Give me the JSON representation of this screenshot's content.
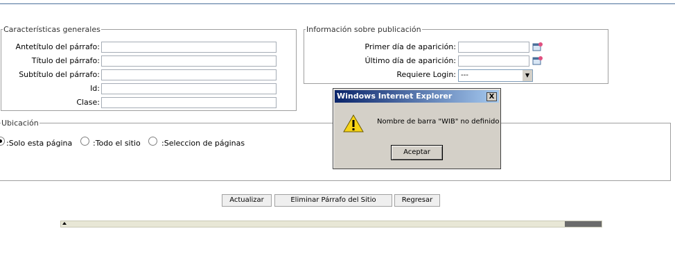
{
  "general": {
    "legend": "Características generales",
    "fields": [
      {
        "label": "Antetítulo del párrafo:",
        "value": ""
      },
      {
        "label": "Título del párrafo:",
        "value": ""
      },
      {
        "label": "Subtítulo del párrafo:",
        "value": ""
      },
      {
        "label": "Id:",
        "value": ""
      },
      {
        "label": "Clase:",
        "value": ""
      }
    ]
  },
  "publication": {
    "legend": "Información sobre publicación",
    "first_day_label": "Primer día de aparición:",
    "first_day_value": "",
    "last_day_label": "Último día de aparición:",
    "last_day_value": "",
    "login_label": "Requiere Login:",
    "login_value": "---"
  },
  "location": {
    "legend": "Ubicación",
    "options": [
      {
        "label": ":Solo esta página",
        "selected": true
      },
      {
        "label": ":Todo el sitio",
        "selected": false
      },
      {
        "label": ":Seleccion de páginas",
        "selected": false
      }
    ]
  },
  "buttons": {
    "update": "Actualizar",
    "delete": "Eliminar Párrafo del Sitio",
    "back": "Regresar"
  },
  "dialog": {
    "title": "Windows Internet Explorer",
    "close": "X",
    "message": "Nombre de barra \"WIB\" no definido",
    "ok": "Aceptar"
  },
  "colors": {
    "titlebar_start": "#0a246a",
    "titlebar_end": "#a6caf0",
    "dialog_bg": "#d4d0c8"
  }
}
